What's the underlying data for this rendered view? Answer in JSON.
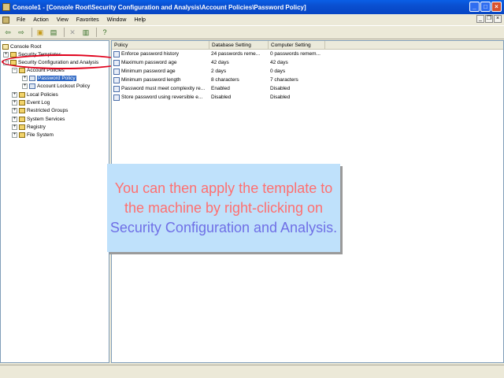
{
  "window": {
    "title": "Console1 - [Console Root\\Security Configuration and Analysis\\Account Policies\\Password Policy]"
  },
  "menu": {
    "items": [
      "File",
      "Action",
      "View",
      "Favorites",
      "Window",
      "Help"
    ]
  },
  "tree": {
    "root": "Console Root",
    "security_templates": "Security Templates",
    "sca": "Security Configuration and Analysis",
    "account_policies": "Account Policies",
    "password_policy": "Password Policy",
    "account_lockout_policy": "Account Lockout Policy",
    "local_policies": "Local Policies",
    "event_log": "Event Log",
    "restricted_groups": "Restricted Groups",
    "system_services": "System Services",
    "registry": "Registry",
    "file_system": "File System"
  },
  "list": {
    "headers": {
      "policy": "Policy",
      "database": "Database Setting",
      "computer": "Computer Setting"
    },
    "rows": [
      {
        "policy": "Enforce password history",
        "database": "24 passwords reme...",
        "computer": "0 passwords remem..."
      },
      {
        "policy": "Maximum password age",
        "database": "42 days",
        "computer": "42 days"
      },
      {
        "policy": "Minimum password age",
        "database": "2 days",
        "computer": "0 days"
      },
      {
        "policy": "Minimum password length",
        "database": "8 characters",
        "computer": "7 characters"
      },
      {
        "policy": "Password must meet complexity re...",
        "database": "Enabled",
        "computer": "Disabled"
      },
      {
        "policy": "Store password using reversible e...",
        "database": "Disabled",
        "computer": "Disabled"
      }
    ]
  },
  "callout": {
    "text_part1": "You can then apply the template to the machine by right-clicking on ",
    "highlight": "Security Configuration and Analysis",
    "text_part2": "."
  },
  "colors": {
    "highlight_ellipse": "#e0001b",
    "callout_bg": "#bfe1fb",
    "callout_text": "#ff6f6f",
    "callout_highlight": "#6f6fe6"
  }
}
